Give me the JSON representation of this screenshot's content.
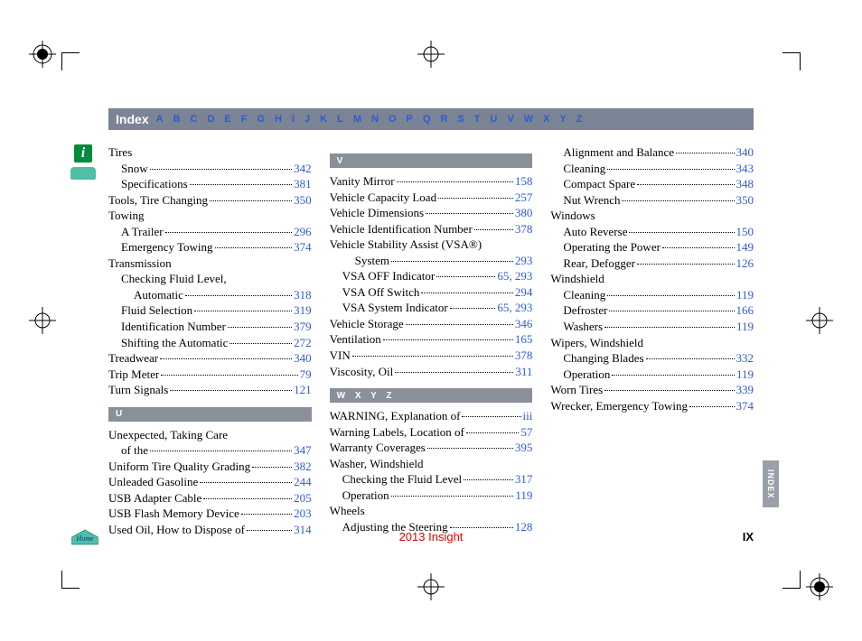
{
  "nav": {
    "title": "Index",
    "letters": [
      "A",
      "B",
      "C",
      "D",
      "E",
      "F",
      "G",
      "H",
      "I",
      "J",
      "K",
      "L",
      "M",
      "N",
      "O",
      "P",
      "Q",
      "R",
      "S",
      "T",
      "U",
      "V",
      "W",
      "X",
      "Y",
      "Z"
    ]
  },
  "columns": [
    {
      "blocks": [
        {
          "header": null,
          "entries": [
            {
              "label": "Tires",
              "pages": null,
              "indent": 0
            },
            {
              "label": "Snow",
              "pages": "342",
              "indent": 1
            },
            {
              "label": "Specifications",
              "pages": "381",
              "indent": 1
            },
            {
              "label": "Tools, Tire Changing",
              "pages": "350",
              "indent": 0
            },
            {
              "label": "Towing",
              "pages": null,
              "indent": 0
            },
            {
              "label": "A Trailer",
              "pages": "296",
              "indent": 1
            },
            {
              "label": "Emergency Towing",
              "pages": "374",
              "indent": 1
            },
            {
              "label": "Transmission",
              "pages": null,
              "indent": 0
            },
            {
              "label": "Checking Fluid Level,",
              "pages": null,
              "indent": 1,
              "nodots": true
            },
            {
              "label": "Automatic",
              "pages": "318",
              "indent": 2
            },
            {
              "label": "Fluid Selection",
              "pages": "319",
              "indent": 1
            },
            {
              "label": "Identification Number",
              "pages": "379",
              "indent": 1
            },
            {
              "label": "Shifting the Automatic",
              "pages": "272",
              "indent": 1
            },
            {
              "label": "Treadwear",
              "pages": "340",
              "indent": 0
            },
            {
              "label": "Trip Meter",
              "pages": "79",
              "indent": 0
            },
            {
              "label": "Turn Signals",
              "pages": "121",
              "indent": 0
            }
          ]
        },
        {
          "header": "U",
          "entries": [
            {
              "label": "Unexpected, Taking Care",
              "pages": null,
              "indent": 0,
              "nodots": true
            },
            {
              "label": "of the",
              "pages": "347",
              "indent": 1
            },
            {
              "label": "Uniform Tire Quality Grading",
              "pages": "382",
              "indent": 0
            },
            {
              "label": "Unleaded Gasoline",
              "pages": "244",
              "indent": 0
            },
            {
              "label": "USB Adapter Cable",
              "pages": "205",
              "indent": 0
            },
            {
              "label": "USB Flash Memory Device",
              "pages": "203",
              "indent": 0
            },
            {
              "label": "Used Oil, How to Dispose of",
              "pages": "314",
              "indent": 0
            }
          ]
        }
      ]
    },
    {
      "blocks": [
        {
          "header": "V",
          "entries": [
            {
              "label": "Vanity Mirror",
              "pages": "158",
              "indent": 0
            },
            {
              "label": "Vehicle Capacity Load",
              "pages": "257",
              "indent": 0
            },
            {
              "label": "Vehicle Dimensions",
              "pages": "380",
              "indent": 0
            },
            {
              "label": "Vehicle Identification Number",
              "pages": "378",
              "indent": 0
            },
            {
              "label": "Vehicle Stability Assist (VSA®)",
              "pages": null,
              "indent": 0,
              "nodots": true
            },
            {
              "label": "System",
              "pages": "293",
              "indent": 2
            },
            {
              "label": "VSA OFF Indicator",
              "pages": "65, 293",
              "indent": 1
            },
            {
              "label": "VSA Off Switch",
              "pages": "294",
              "indent": 1
            },
            {
              "label": "VSA System Indicator",
              "pages": "65, 293",
              "indent": 1
            },
            {
              "label": "Vehicle Storage",
              "pages": "346",
              "indent": 0
            },
            {
              "label": "Ventilation",
              "pages": "165",
              "indent": 0
            },
            {
              "label": "VIN",
              "pages": "378",
              "indent": 0
            },
            {
              "label": "Viscosity, Oil",
              "pages": "311",
              "indent": 0
            }
          ]
        },
        {
          "header": "W   X   Y   Z",
          "entries": [
            {
              "label": "WARNING, Explanation of",
              "pages": "iii",
              "indent": 0
            },
            {
              "label": "Warning Labels, Location of",
              "pages": "57",
              "indent": 0
            },
            {
              "label": "Warranty Coverages",
              "pages": "395",
              "indent": 0
            },
            {
              "label": "Washer, Windshield",
              "pages": null,
              "indent": 0
            },
            {
              "label": "Checking the Fluid Level",
              "pages": "317",
              "indent": 1
            },
            {
              "label": "Operation",
              "pages": "119",
              "indent": 1
            },
            {
              "label": "Wheels",
              "pages": null,
              "indent": 0
            },
            {
              "label": "Adjusting the Steering",
              "pages": "128",
              "indent": 1
            }
          ]
        }
      ]
    },
    {
      "blocks": [
        {
          "header": null,
          "entries": [
            {
              "label": "Alignment and Balance",
              "pages": "340",
              "indent": 1
            },
            {
              "label": "Cleaning",
              "pages": "343",
              "indent": 1
            },
            {
              "label": "Compact Spare",
              "pages": "348",
              "indent": 1
            },
            {
              "label": "Nut Wrench",
              "pages": "350",
              "indent": 1
            },
            {
              "label": "Windows",
              "pages": null,
              "indent": 0
            },
            {
              "label": "Auto Reverse",
              "pages": "150",
              "indent": 1
            },
            {
              "label": "Operating the Power",
              "pages": "149",
              "indent": 1
            },
            {
              "label": "Rear, Defogger",
              "pages": "126",
              "indent": 1
            },
            {
              "label": "Windshield",
              "pages": null,
              "indent": 0
            },
            {
              "label": "Cleaning",
              "pages": "119",
              "indent": 1
            },
            {
              "label": "Defroster",
              "pages": "166",
              "indent": 1
            },
            {
              "label": "Washers",
              "pages": "119",
              "indent": 1
            },
            {
              "label": "Wipers, Windshield",
              "pages": null,
              "indent": 0
            },
            {
              "label": "Changing Blades",
              "pages": "332",
              "indent": 1
            },
            {
              "label": "Operation",
              "pages": "119",
              "indent": 1
            },
            {
              "label": "Worn Tires",
              "pages": "339",
              "indent": 0
            },
            {
              "label": "Wrecker, Emergency Towing",
              "pages": "374",
              "indent": 0
            }
          ]
        }
      ]
    }
  ],
  "footer": {
    "model": "2013 Insight",
    "page": "IX"
  },
  "sideTab": "INDEX",
  "infoIcon": "i",
  "homeLabel": "Home"
}
